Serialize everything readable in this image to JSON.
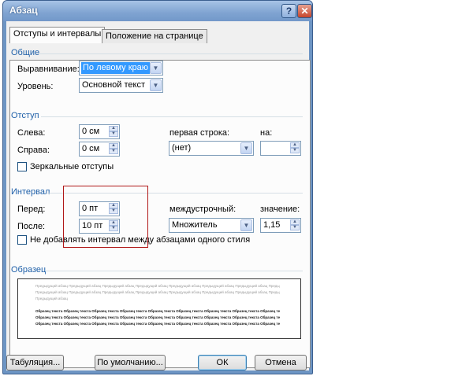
{
  "window": {
    "title": "Абзац",
    "help": "?",
    "close": "✕"
  },
  "tabs": [
    "Отступы и интервалы",
    "Положение на странице"
  ],
  "general": {
    "title": "Общие",
    "alignment_label": "Выравнивание:",
    "alignment_value": "По левому краю",
    "level_label": "Уровень:",
    "level_value": "Основной текст"
  },
  "indent": {
    "title": "Отступ",
    "left_label": "Слева:",
    "left_value": "0 см",
    "right_label": "Справа:",
    "right_value": "0 см",
    "first_line_label": "первая строка:",
    "first_line_value": "(нет)",
    "by_label": "на:",
    "by_value": "",
    "mirror_label": "Зеркальные отступы"
  },
  "spacing": {
    "title": "Интервал",
    "before_label": "Перед:",
    "before_value": "0 пт",
    "after_label": "После:",
    "after_value": "10 пт",
    "line_label": "междустрочный:",
    "line_value": "Множитель",
    "at_label": "значение:",
    "at_value": "1,15",
    "no_space_label": "Не добавлять интервал между абзацами одного стиля"
  },
  "preview": {
    "title": "Образец",
    "prev_line": "Предыдущий абзац Предыдущий абзац Предыдущий абзац Предыдущий абзац Предыдущий абзац Предыдущий абзац Предыдущий абзац Предыдущий абзац",
    "prev_line_short": "Предыдущий абзац",
    "sample_line": "Образец текста Образец текста Образец текста Образец текста Образец текста Образец текста Образец текста Образец текста Образец текста"
  },
  "buttons": {
    "tabs": "Табуляция...",
    "default": "По умолчанию...",
    "ok": "ОК",
    "cancel": "Отмена"
  }
}
